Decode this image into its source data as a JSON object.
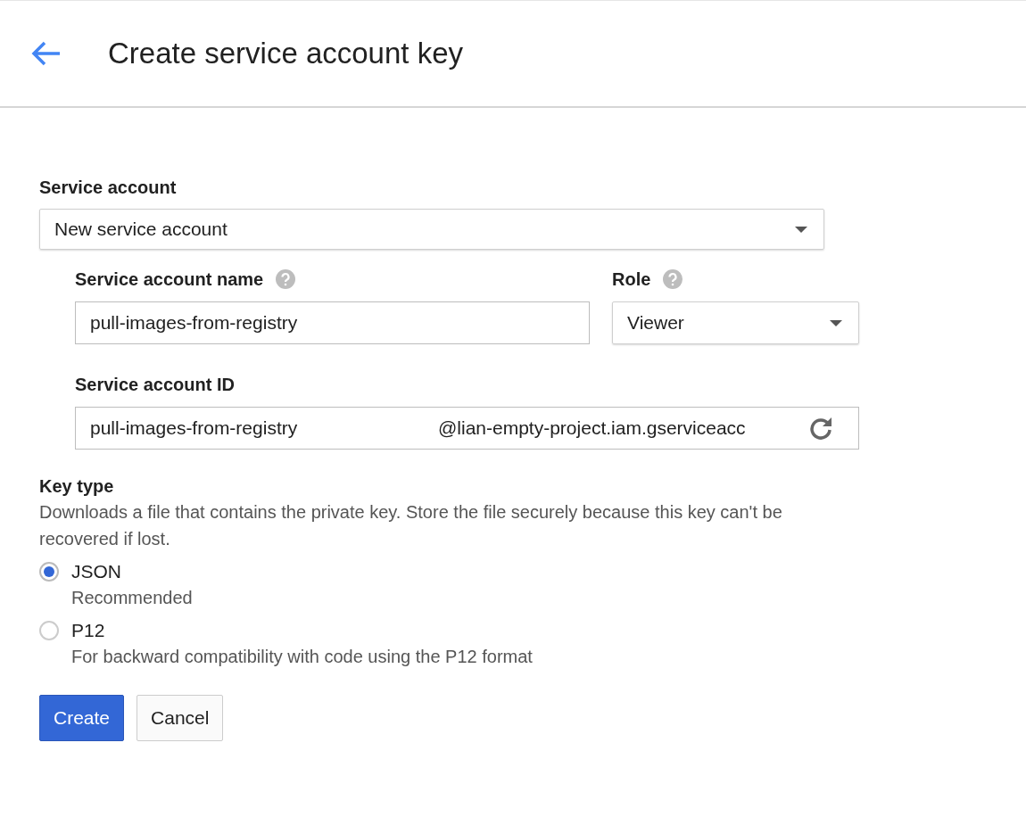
{
  "header": {
    "title": "Create service account key"
  },
  "service_account": {
    "label": "Service account",
    "value": "New service account"
  },
  "name_field": {
    "label": "Service account name",
    "value": "pull-images-from-registry"
  },
  "role": {
    "label": "Role",
    "value": "Viewer"
  },
  "id_field": {
    "label": "Service account ID",
    "value": "pull-images-from-registry",
    "suffix": "@lian-empty-project.iam.gserviceacc"
  },
  "key_type": {
    "label": "Key type",
    "description": "Downloads a file that contains the private key. Store the file securely because this key can't be recovered if lost.",
    "options": [
      {
        "label": "JSON",
        "hint": "Recommended",
        "selected": true
      },
      {
        "label": "P12",
        "hint": "For backward compatibility with code using the P12 format",
        "selected": false
      }
    ]
  },
  "buttons": [
    {
      "label": "Create",
      "kind": "primary"
    },
    {
      "label": "Cancel",
      "kind": "secondary"
    }
  ]
}
